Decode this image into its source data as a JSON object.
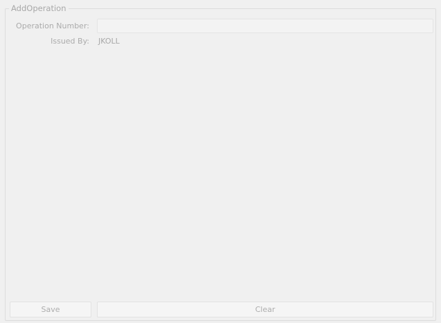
{
  "form": {
    "title": "AddOperation",
    "operation_number_label": "Operation Number:",
    "operation_number_value": "",
    "issued_by_label": "Issued By:",
    "issued_by_value": "JKOLL"
  },
  "actions": {
    "save_label": "Save",
    "clear_label": "Clear"
  }
}
